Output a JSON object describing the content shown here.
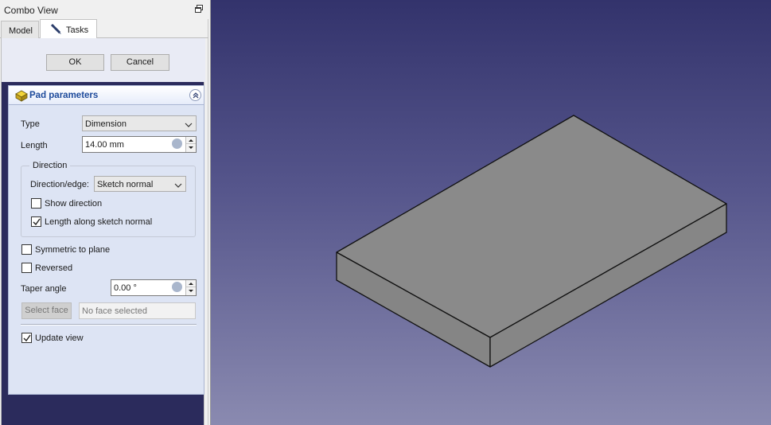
{
  "combo_view": {
    "title": "Combo View",
    "tabs": [
      {
        "label": "Model"
      },
      {
        "label": "Tasks"
      }
    ]
  },
  "dialog": {
    "ok_label": "OK",
    "cancel_label": "Cancel"
  },
  "pad_parameters": {
    "title": "Pad parameters",
    "type_label": "Type",
    "type_value": "Dimension",
    "length_label": "Length",
    "length_value": "14.00 mm",
    "direction": {
      "group_label": "Direction",
      "edge_label": "Direction/edge:",
      "edge_value": "Sketch normal",
      "show_direction_label": "Show direction",
      "show_direction_checked": false,
      "length_along_normal_label": "Length along sketch normal",
      "length_along_normal_checked": true
    },
    "symmetric_label": "Symmetric to plane",
    "symmetric_checked": false,
    "reversed_label": "Reversed",
    "reversed_checked": false,
    "taper_label": "Taper angle",
    "taper_value": "0.00 °",
    "select_face_label": "Select face",
    "face_field_value": "No face selected",
    "update_view_label": "Update view",
    "update_view_checked": true
  },
  "colors": {
    "viewport_top": "#33336c",
    "viewport_bottom": "#8a8ab0",
    "solid_face": "#8a8a8a",
    "solid_edge": "#111111"
  }
}
